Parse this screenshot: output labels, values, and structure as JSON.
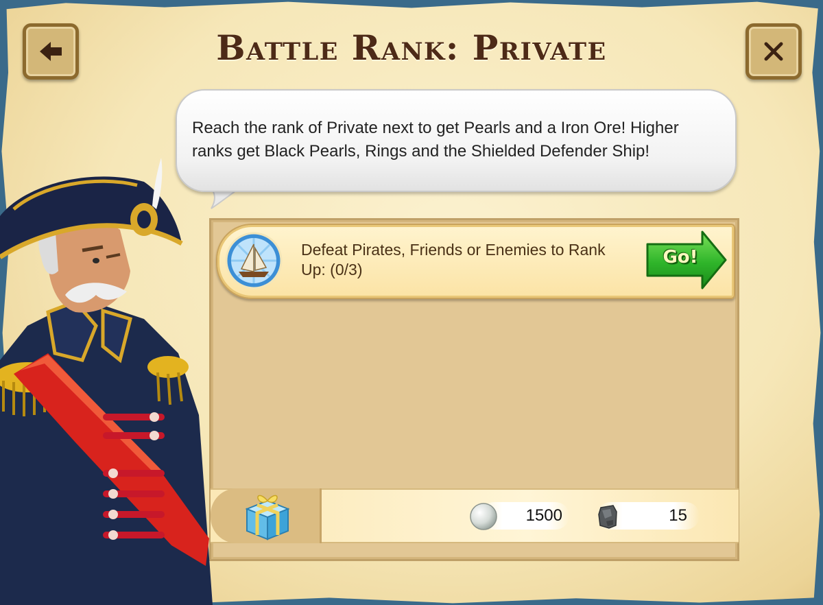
{
  "title": "Battle Rank: Private",
  "speech": "Reach the rank of Private next to get Pearls and a Iron Ore! Higher ranks get Black Pearls, Rings and the Shielded Defender Ship!",
  "task": {
    "text": "Defeat Pirates, Friends or Enemies to Rank Up: (0/3)",
    "go_label": "Go!",
    "icon": "ship-icon"
  },
  "rewards": [
    {
      "icon": "pearl-icon",
      "value": "1500"
    },
    {
      "icon": "iron-ore-icon",
      "value": "15"
    }
  ],
  "buttons": {
    "back": "back-arrow-icon",
    "close": "close-icon"
  },
  "colors": {
    "title": "#4d2a17",
    "go_button": "#2fb52a",
    "parchment": "#f6e7b8"
  }
}
